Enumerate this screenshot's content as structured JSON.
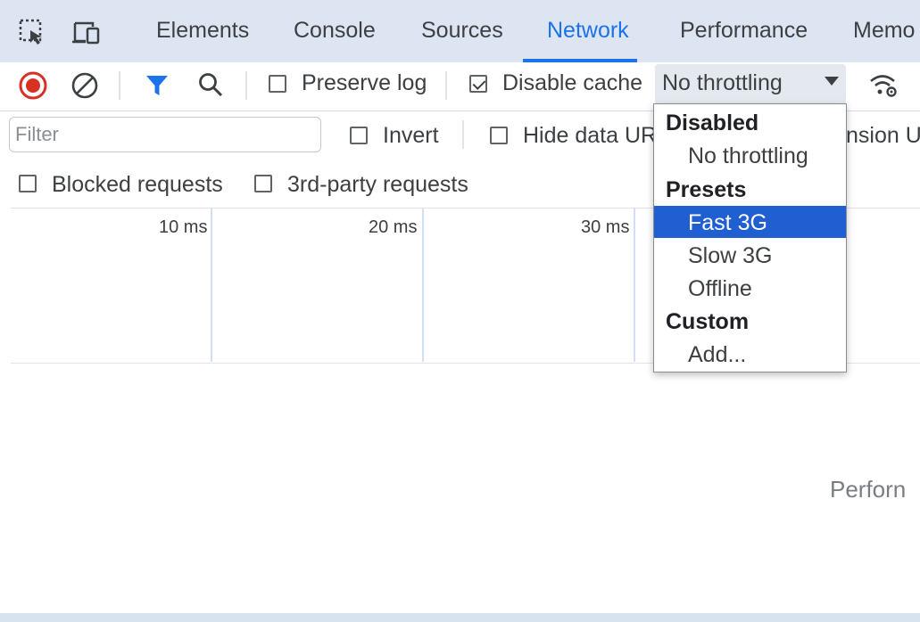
{
  "tabs": [
    {
      "label": "Elements"
    },
    {
      "label": "Console"
    },
    {
      "label": "Sources"
    },
    {
      "label": "Network"
    },
    {
      "label": "Performance"
    },
    {
      "label": "Memo"
    }
  ],
  "active_tab": "Network",
  "toolbar": {
    "preserve_log": {
      "label": "Preserve log",
      "checked": false
    },
    "disable_cache": {
      "label": "Disable cache",
      "checked": true
    },
    "throttling_value": "No throttling"
  },
  "filters": {
    "placeholder": "Filter",
    "invert": {
      "label": "Invert",
      "checked": false
    },
    "hide_data_urls": {
      "label": "Hide data UR",
      "checked": false
    },
    "hide_extension_urls_partial": "nsion U",
    "blocked_requests": {
      "label": "Blocked requests",
      "checked": false
    },
    "third_party_requests": {
      "label": "3rd-party requests",
      "checked": false
    }
  },
  "timeline": {
    "ticks": [
      "10 ms",
      "20 ms",
      "30 ms"
    ]
  },
  "perf_hint": "Perforn",
  "throttle_menu": {
    "groups": [
      {
        "header": "Disabled",
        "items": [
          "No throttling"
        ]
      },
      {
        "header": "Presets",
        "items": [
          "Fast 3G",
          "Slow 3G",
          "Offline"
        ]
      },
      {
        "header": "Custom",
        "items": [
          "Add..."
        ]
      }
    ],
    "highlighted": "Fast 3G"
  },
  "colors": {
    "accent": "#1a73e8",
    "tabbar_bg": "#dde5f2",
    "record_red": "#d93025",
    "menu_highlight": "#1f5fd1"
  },
  "icons": {
    "inspect": "inspect-element-icon",
    "device": "device-toolbar-icon",
    "record": "record-stop-icon",
    "clear": "clear-icon",
    "filter": "filter-icon",
    "search": "search-icon",
    "network_conditions": "network-conditions-icon",
    "dropdown": "chevron-down-icon"
  }
}
